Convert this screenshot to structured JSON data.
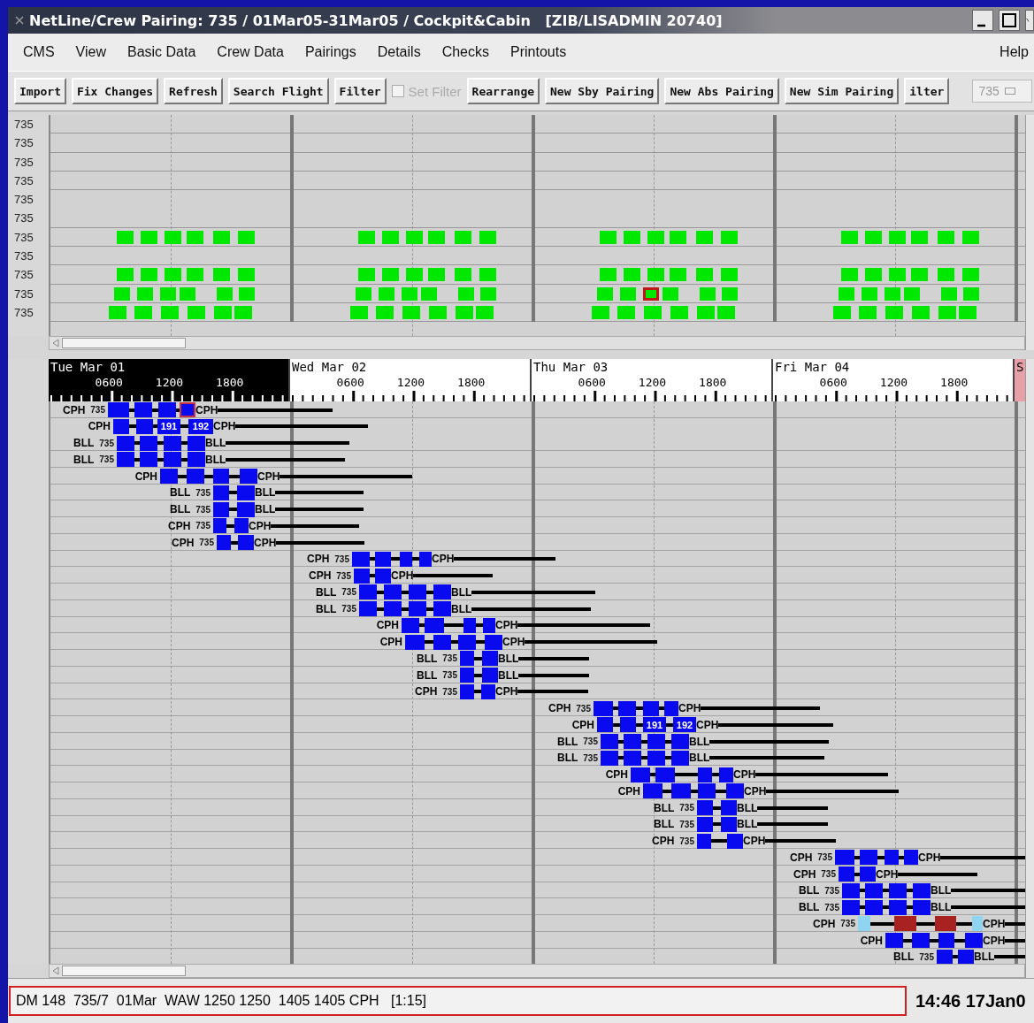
{
  "window": {
    "title": "NetLine/Crew Pairing: 735 / 01Mar05-31Mar05 / Cockpit&Cabin   [ZIB/LISADMIN 20740]"
  },
  "menu": {
    "items": [
      "CMS",
      "View",
      "Basic Data",
      "Crew Data",
      "Pairings",
      "Details",
      "Checks",
      "Printouts"
    ],
    "help": "Help"
  },
  "toolbar": [
    {
      "kind": "button",
      "label": "Import",
      "disabled": false
    },
    {
      "kind": "button",
      "label": "Fix Changes",
      "disabled": false
    },
    {
      "kind": "button",
      "label": "Refresh",
      "disabled": false
    },
    {
      "kind": "button",
      "label": "Search Flight",
      "disabled": false
    },
    {
      "kind": "button",
      "label": "Filter",
      "disabled": false
    },
    {
      "kind": "checkbox",
      "label": "Set Filter",
      "checked": false,
      "disabled": true
    },
    {
      "kind": "button",
      "label": "Rearrange",
      "disabled": false
    },
    {
      "kind": "button",
      "label": "New Sby Pairing",
      "disabled": false
    },
    {
      "kind": "button",
      "label": "New Abs Pairing",
      "disabled": false
    },
    {
      "kind": "button",
      "label": "New Sim Pairing",
      "disabled": false
    },
    {
      "kind": "button",
      "label": "ilter",
      "disabled": false
    },
    {
      "kind": "field",
      "value": "735",
      "disabled": true
    }
  ],
  "overview": {
    "rows": [
      "735",
      "735",
      "735",
      "735",
      "735",
      "735",
      "735",
      "735",
      "735",
      "735",
      "735"
    ],
    "days": [
      {
        "selected": false
      },
      {
        "selected": false
      },
      {
        "selected": true
      },
      {
        "selected": false
      }
    ]
  },
  "gantt": {
    "days": [
      {
        "kind": "weekday",
        "label": "Tue Mar 01",
        "selected": true,
        "ticks": [
          "0600",
          "1200",
          "1800"
        ]
      },
      {
        "kind": "weekday",
        "label": "Wed Mar 02",
        "selected": false,
        "ticks": [
          "0600",
          "1200",
          "1800"
        ]
      },
      {
        "kind": "weekday",
        "label": "Thu Mar 03",
        "selected": false,
        "ticks": [
          "0600",
          "1200",
          "1800"
        ]
      },
      {
        "kind": "weekday",
        "label": "Fri Mar 04",
        "selected": false,
        "ticks": [
          "0600",
          "1200",
          "1800"
        ]
      },
      {
        "kind": "weekend",
        "label": "S",
        "selected": false
      }
    ],
    "pairings": [
      {
        "origin": "CPH",
        "fleet": "735",
        "end": "CPH",
        "legs": [
          {
            "color": "#0a0af0",
            "selected": false
          },
          {
            "color": "#0a0af0",
            "selected": false
          },
          {
            "color": "#0a0af0",
            "selected": false
          },
          {
            "color": "#0a0af0",
            "selected": true
          }
        ]
      },
      {
        "origin": "CPH",
        "end": "CPH",
        "legs": [
          {
            "color": "#0a0af0",
            "selected": false
          },
          {
            "color": "#0a0af0",
            "selected": false
          },
          {
            "color": "#0a0af0",
            "selected": false,
            "label": "191"
          },
          {
            "color": "#0a0af0",
            "selected": false,
            "label": "192"
          }
        ]
      },
      {
        "origin": "BLL",
        "fleet": "735",
        "end": "BLL",
        "legs": [
          {
            "color": "#0a0af0",
            "selected": false
          },
          {
            "color": "#0a0af0",
            "selected": false
          },
          {
            "color": "#0a0af0",
            "selected": false
          },
          {
            "color": "#0a0af0",
            "selected": false
          }
        ]
      },
      {
        "origin": "BLL",
        "fleet": "735",
        "end": "BLL",
        "legs": [
          {
            "color": "#0a0af0",
            "selected": false
          },
          {
            "color": "#0a0af0",
            "selected": false
          },
          {
            "color": "#0a0af0",
            "selected": false
          },
          {
            "color": "#0a0af0",
            "selected": false
          }
        ]
      },
      {
        "origin": "CPH",
        "end": "CPH",
        "legs": [
          {
            "color": "#0a0af0",
            "selected": false
          },
          {
            "color": "#0a0af0",
            "selected": false
          },
          {
            "color": "#0a0af0",
            "selected": false
          },
          {
            "color": "#0a0af0",
            "selected": false
          }
        ]
      },
      {
        "origin": "BLL",
        "fleet": "735",
        "end": "BLL",
        "legs": [
          {
            "color": "#0a0af0",
            "selected": false
          },
          {
            "color": "#0a0af0",
            "selected": false
          }
        ]
      },
      {
        "origin": "BLL",
        "fleet": "735",
        "end": "BLL",
        "legs": [
          {
            "color": "#0a0af0",
            "selected": false
          },
          {
            "color": "#0a0af0",
            "selected": false
          }
        ]
      },
      {
        "origin": "CPH",
        "fleet": "735",
        "end": "CPH",
        "legs": [
          {
            "color": "#0a0af0",
            "selected": false
          },
          {
            "color": "#0a0af0",
            "selected": false
          }
        ]
      },
      {
        "origin": "CPH",
        "fleet": "735",
        "end": "CPH",
        "legs": [
          {
            "color": "#0a0af0",
            "selected": false
          },
          {
            "color": "#0a0af0",
            "selected": false
          }
        ]
      },
      {
        "origin": "CPH",
        "fleet": "735",
        "end": "CPH",
        "legs": [
          {
            "color": "#0a0af0",
            "selected": false
          },
          {
            "color": "#0a0af0",
            "selected": false
          },
          {
            "color": "#0a0af0",
            "selected": false
          },
          {
            "color": "#0a0af0",
            "selected": false
          }
        ]
      },
      {
        "origin": "CPH",
        "fleet": "735",
        "end": "CPH",
        "legs": [
          {
            "color": "#0a0af0",
            "selected": false
          },
          {
            "color": "#0a0af0",
            "selected": false
          }
        ]
      },
      {
        "origin": "BLL",
        "fleet": "735",
        "end": "BLL",
        "legs": [
          {
            "color": "#0a0af0",
            "selected": false
          },
          {
            "color": "#0a0af0",
            "selected": false
          },
          {
            "color": "#0a0af0",
            "selected": false
          },
          {
            "color": "#0a0af0",
            "selected": false
          }
        ]
      },
      {
        "origin": "BLL",
        "fleet": "735",
        "end": "BLL",
        "legs": [
          {
            "color": "#0a0af0",
            "selected": false
          },
          {
            "color": "#0a0af0",
            "selected": false
          },
          {
            "color": "#0a0af0",
            "selected": false
          },
          {
            "color": "#0a0af0",
            "selected": false
          }
        ]
      },
      {
        "origin": "CPH",
        "end": "CPH",
        "legs": [
          {
            "color": "#0a0af0",
            "selected": false
          },
          {
            "color": "#0a0af0",
            "selected": false
          },
          {
            "color": "#0a0af0",
            "selected": false
          },
          {
            "color": "#0a0af0",
            "selected": false
          }
        ]
      },
      {
        "origin": "CPH",
        "end": "CPH",
        "legs": [
          {
            "color": "#0a0af0",
            "selected": false
          },
          {
            "color": "#0a0af0",
            "selected": false
          },
          {
            "color": "#0a0af0",
            "selected": false
          },
          {
            "color": "#0a0af0",
            "selected": false
          }
        ]
      },
      {
        "origin": "BLL",
        "fleet": "735",
        "end": "BLL",
        "legs": [
          {
            "color": "#0a0af0",
            "selected": false
          },
          {
            "color": "#0a0af0",
            "selected": false
          }
        ]
      },
      {
        "origin": "BLL",
        "fleet": "735",
        "end": "BLL",
        "legs": [
          {
            "color": "#0a0af0",
            "selected": false
          },
          {
            "color": "#0a0af0",
            "selected": false
          }
        ]
      },
      {
        "origin": "CPH",
        "fleet": "735",
        "end": "CPH",
        "legs": [
          {
            "color": "#0a0af0",
            "selected": false
          },
          {
            "color": "#0a0af0",
            "selected": false
          }
        ]
      },
      {
        "origin": "CPH",
        "fleet": "735",
        "end": "CPH",
        "legs": [
          {
            "color": "#0a0af0",
            "selected": false
          },
          {
            "color": "#0a0af0",
            "selected": false
          },
          {
            "color": "#0a0af0",
            "selected": false
          },
          {
            "color": "#0a0af0",
            "selected": false
          }
        ]
      },
      {
        "origin": "CPH",
        "end": "CPH",
        "legs": [
          {
            "color": "#0a0af0",
            "selected": false
          },
          {
            "color": "#0a0af0",
            "selected": false
          },
          {
            "color": "#0a0af0",
            "selected": false,
            "label": "191"
          },
          {
            "color": "#0a0af0",
            "selected": false,
            "label": "192"
          }
        ]
      },
      {
        "origin": "BLL",
        "fleet": "735",
        "end": "BLL",
        "legs": [
          {
            "color": "#0a0af0",
            "selected": false
          },
          {
            "color": "#0a0af0",
            "selected": false
          },
          {
            "color": "#0a0af0",
            "selected": false
          },
          {
            "color": "#0a0af0",
            "selected": false
          }
        ]
      },
      {
        "origin": "BLL",
        "fleet": "735",
        "end": "BLL",
        "legs": [
          {
            "color": "#0a0af0",
            "selected": false
          },
          {
            "color": "#0a0af0",
            "selected": false
          },
          {
            "color": "#0a0af0",
            "selected": false
          },
          {
            "color": "#0a0af0",
            "selected": false
          }
        ]
      },
      {
        "origin": "CPH",
        "end": "CPH",
        "legs": [
          {
            "color": "#0a0af0",
            "selected": false
          },
          {
            "color": "#0a0af0",
            "selected": false
          },
          {
            "color": "#0a0af0",
            "selected": false
          },
          {
            "color": "#0a0af0",
            "selected": false
          }
        ]
      },
      {
        "origin": "CPH",
        "end": "CPH",
        "legs": [
          {
            "color": "#0a0af0",
            "selected": false
          },
          {
            "color": "#0a0af0",
            "selected": false
          },
          {
            "color": "#0a0af0",
            "selected": false
          },
          {
            "color": "#0a0af0",
            "selected": false
          }
        ]
      },
      {
        "origin": "BLL",
        "fleet": "735",
        "end": "BLL",
        "legs": [
          {
            "color": "#0a0af0",
            "selected": false
          },
          {
            "color": "#0a0af0",
            "selected": false
          }
        ]
      },
      {
        "origin": "BLL",
        "fleet": "735",
        "end": "BLL",
        "legs": [
          {
            "color": "#0a0af0",
            "selected": false
          },
          {
            "color": "#0a0af0",
            "selected": false
          }
        ]
      },
      {
        "origin": "CPH",
        "fleet": "735",
        "end": "CPH",
        "legs": [
          {
            "color": "#0a0af0",
            "selected": false
          },
          {
            "color": "#0a0af0",
            "selected": false
          }
        ]
      },
      {
        "origin": "CPH",
        "fleet": "735",
        "end": "CPH",
        "legs": [
          {
            "color": "#0a0af0",
            "selected": false
          },
          {
            "color": "#0a0af0",
            "selected": false
          },
          {
            "color": "#0a0af0",
            "selected": false
          },
          {
            "color": "#0a0af0",
            "selected": false
          }
        ]
      },
      {
        "origin": "CPH",
        "fleet": "735",
        "end": "CPH",
        "legs": [
          {
            "color": "#0a0af0",
            "selected": false
          },
          {
            "color": "#0a0af0",
            "selected": false
          }
        ]
      },
      {
        "origin": "BLL",
        "fleet": "735",
        "end": "BLL",
        "legs": [
          {
            "color": "#0a0af0",
            "selected": false
          },
          {
            "color": "#0a0af0",
            "selected": false
          },
          {
            "color": "#0a0af0",
            "selected": false
          },
          {
            "color": "#0a0af0",
            "selected": false
          }
        ]
      },
      {
        "origin": "BLL",
        "fleet": "735",
        "end": "BLL",
        "legs": [
          {
            "color": "#0a0af0",
            "selected": false
          },
          {
            "color": "#0a0af0",
            "selected": false
          },
          {
            "color": "#0a0af0",
            "selected": false
          },
          {
            "color": "#0a0af0",
            "selected": false
          }
        ]
      },
      {
        "origin": "CPH",
        "fleet": "735",
        "end": "CPH",
        "legs": [
          {
            "color": "#8fd4f0",
            "selected": false
          },
          {
            "color": "#a82222",
            "selected": false
          },
          {
            "color": "#a82222",
            "selected": false
          },
          {
            "color": "#8fd4f0",
            "selected": false
          }
        ]
      },
      {
        "origin": "CPH",
        "end": "CPH",
        "legs": [
          {
            "color": "#0a0af0",
            "selected": false
          },
          {
            "color": "#0a0af0",
            "selected": false
          },
          {
            "color": "#0a0af0",
            "selected": false
          },
          {
            "color": "#0a0af0",
            "selected": false
          }
        ]
      },
      {
        "origin": "BLL",
        "fleet": "735",
        "end": "BLL",
        "legs": [
          {
            "color": "#0a0af0",
            "selected": false
          },
          {
            "color": "#0a0af0",
            "selected": false
          }
        ]
      }
    ]
  },
  "status_bar": {
    "message": "DM 148  735/7  01Mar  WAW 1250 1250  1405 1405 CPH   [1:15]",
    "clock": "14:46 17Jan0"
  }
}
